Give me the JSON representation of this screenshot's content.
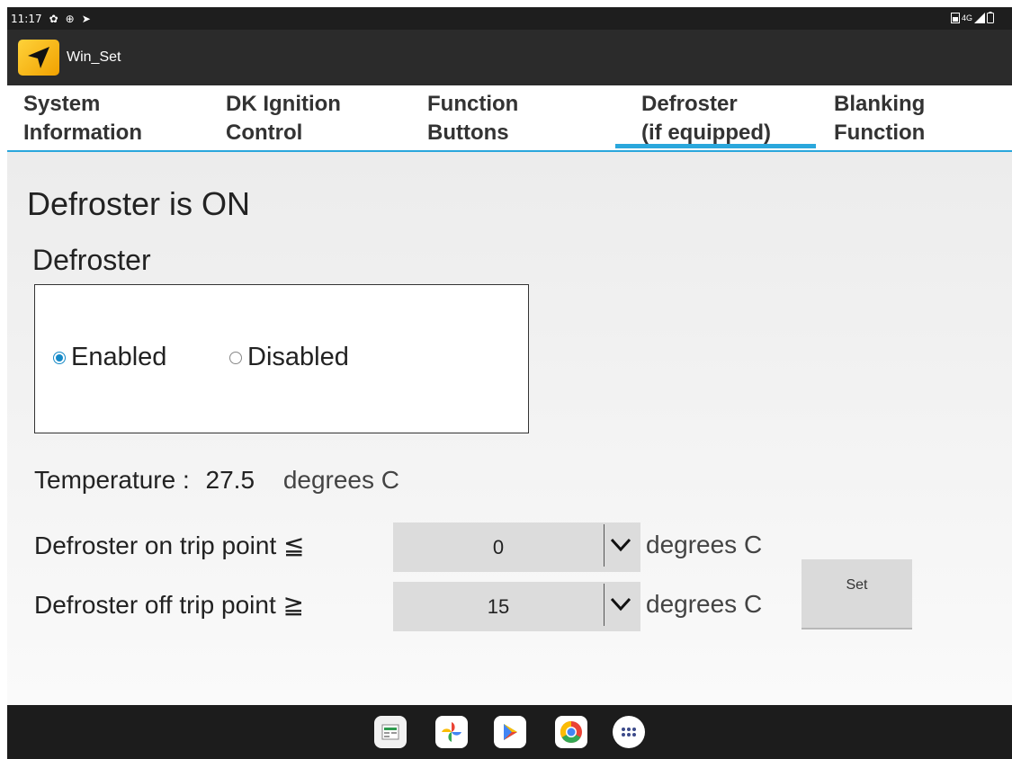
{
  "status_bar": {
    "time": "11:17",
    "icons_left": [
      "gear-icon",
      "sync-icon",
      "location-icon"
    ],
    "icons_right": [
      "sim-icon",
      "signal-4g-icon",
      "battery-icon"
    ],
    "network_label": "4G"
  },
  "app": {
    "title": "Win_Set",
    "logo": "navigation-arrow-icon",
    "accent": "#2aa7dc"
  },
  "tabs": [
    {
      "line1": "System",
      "line2": "Information"
    },
    {
      "line1": "DK Ignition",
      "line2": "Control"
    },
    {
      "line1": "Function",
      "line2": "Buttons"
    },
    {
      "line1": "Defroster",
      "line2": "(if equipped)",
      "active": true
    },
    {
      "line1": "Blanking",
      "line2": "Function"
    }
  ],
  "main": {
    "status": "Defroster is ON",
    "section_label": "Defroster",
    "radio": {
      "enabled": "Enabled",
      "disabled": "Disabled",
      "selected": "Enabled"
    },
    "temperature": {
      "label": "Temperature :",
      "value": "27.5",
      "unit": "degrees C"
    },
    "on_trip": {
      "label": "Defroster on trip point ≦",
      "value": "0",
      "unit": "degrees C"
    },
    "off_trip": {
      "label": "Defroster off trip point ≧",
      "value": "15",
      "unit": "degrees C"
    },
    "set_button": "Set"
  },
  "taskbar": {
    "apps": [
      "sheets-icon",
      "photos-icon",
      "play-store-icon",
      "chrome-icon",
      "app-drawer-icon"
    ]
  }
}
